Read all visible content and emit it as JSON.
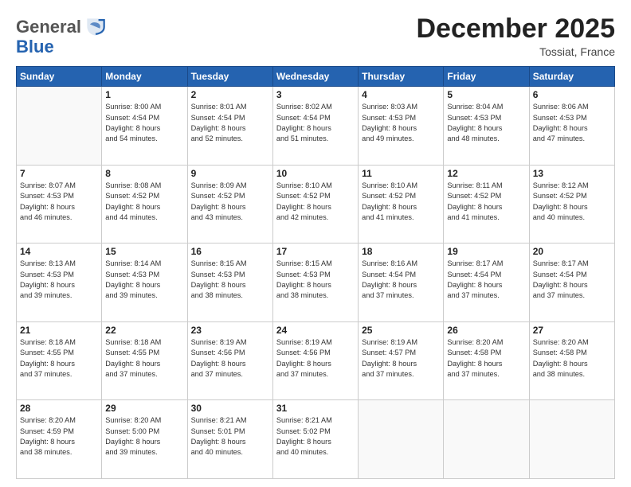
{
  "header": {
    "logo_general": "General",
    "logo_blue": "Blue",
    "month_title": "December 2025",
    "location": "Tossiat, France"
  },
  "weekdays": [
    "Sunday",
    "Monday",
    "Tuesday",
    "Wednesday",
    "Thursday",
    "Friday",
    "Saturday"
  ],
  "weeks": [
    [
      {
        "day": "",
        "sunrise": "",
        "sunset": "",
        "daylight": ""
      },
      {
        "day": "1",
        "sunrise": "Sunrise: 8:00 AM",
        "sunset": "Sunset: 4:54 PM",
        "daylight": "Daylight: 8 hours and 54 minutes."
      },
      {
        "day": "2",
        "sunrise": "Sunrise: 8:01 AM",
        "sunset": "Sunset: 4:54 PM",
        "daylight": "Daylight: 8 hours and 52 minutes."
      },
      {
        "day": "3",
        "sunrise": "Sunrise: 8:02 AM",
        "sunset": "Sunset: 4:54 PM",
        "daylight": "Daylight: 8 hours and 51 minutes."
      },
      {
        "day": "4",
        "sunrise": "Sunrise: 8:03 AM",
        "sunset": "Sunset: 4:53 PM",
        "daylight": "Daylight: 8 hours and 49 minutes."
      },
      {
        "day": "5",
        "sunrise": "Sunrise: 8:04 AM",
        "sunset": "Sunset: 4:53 PM",
        "daylight": "Daylight: 8 hours and 48 minutes."
      },
      {
        "day": "6",
        "sunrise": "Sunrise: 8:06 AM",
        "sunset": "Sunset: 4:53 PM",
        "daylight": "Daylight: 8 hours and 47 minutes."
      }
    ],
    [
      {
        "day": "7",
        "sunrise": "Sunrise: 8:07 AM",
        "sunset": "Sunset: 4:53 PM",
        "daylight": "Daylight: 8 hours and 46 minutes."
      },
      {
        "day": "8",
        "sunrise": "Sunrise: 8:08 AM",
        "sunset": "Sunset: 4:52 PM",
        "daylight": "Daylight: 8 hours and 44 minutes."
      },
      {
        "day": "9",
        "sunrise": "Sunrise: 8:09 AM",
        "sunset": "Sunset: 4:52 PM",
        "daylight": "Daylight: 8 hours and 43 minutes."
      },
      {
        "day": "10",
        "sunrise": "Sunrise: 8:10 AM",
        "sunset": "Sunset: 4:52 PM",
        "daylight": "Daylight: 8 hours and 42 minutes."
      },
      {
        "day": "11",
        "sunrise": "Sunrise: 8:10 AM",
        "sunset": "Sunset: 4:52 PM",
        "daylight": "Daylight: 8 hours and 41 minutes."
      },
      {
        "day": "12",
        "sunrise": "Sunrise: 8:11 AM",
        "sunset": "Sunset: 4:52 PM",
        "daylight": "Daylight: 8 hours and 41 minutes."
      },
      {
        "day": "13",
        "sunrise": "Sunrise: 8:12 AM",
        "sunset": "Sunset: 4:52 PM",
        "daylight": "Daylight: 8 hours and 40 minutes."
      }
    ],
    [
      {
        "day": "14",
        "sunrise": "Sunrise: 8:13 AM",
        "sunset": "Sunset: 4:53 PM",
        "daylight": "Daylight: 8 hours and 39 minutes."
      },
      {
        "day": "15",
        "sunrise": "Sunrise: 8:14 AM",
        "sunset": "Sunset: 4:53 PM",
        "daylight": "Daylight: 8 hours and 39 minutes."
      },
      {
        "day": "16",
        "sunrise": "Sunrise: 8:15 AM",
        "sunset": "Sunset: 4:53 PM",
        "daylight": "Daylight: 8 hours and 38 minutes."
      },
      {
        "day": "17",
        "sunrise": "Sunrise: 8:15 AM",
        "sunset": "Sunset: 4:53 PM",
        "daylight": "Daylight: 8 hours and 38 minutes."
      },
      {
        "day": "18",
        "sunrise": "Sunrise: 8:16 AM",
        "sunset": "Sunset: 4:54 PM",
        "daylight": "Daylight: 8 hours and 37 minutes."
      },
      {
        "day": "19",
        "sunrise": "Sunrise: 8:17 AM",
        "sunset": "Sunset: 4:54 PM",
        "daylight": "Daylight: 8 hours and 37 minutes."
      },
      {
        "day": "20",
        "sunrise": "Sunrise: 8:17 AM",
        "sunset": "Sunset: 4:54 PM",
        "daylight": "Daylight: 8 hours and 37 minutes."
      }
    ],
    [
      {
        "day": "21",
        "sunrise": "Sunrise: 8:18 AM",
        "sunset": "Sunset: 4:55 PM",
        "daylight": "Daylight: 8 hours and 37 minutes."
      },
      {
        "day": "22",
        "sunrise": "Sunrise: 8:18 AM",
        "sunset": "Sunset: 4:55 PM",
        "daylight": "Daylight: 8 hours and 37 minutes."
      },
      {
        "day": "23",
        "sunrise": "Sunrise: 8:19 AM",
        "sunset": "Sunset: 4:56 PM",
        "daylight": "Daylight: 8 hours and 37 minutes."
      },
      {
        "day": "24",
        "sunrise": "Sunrise: 8:19 AM",
        "sunset": "Sunset: 4:56 PM",
        "daylight": "Daylight: 8 hours and 37 minutes."
      },
      {
        "day": "25",
        "sunrise": "Sunrise: 8:19 AM",
        "sunset": "Sunset: 4:57 PM",
        "daylight": "Daylight: 8 hours and 37 minutes."
      },
      {
        "day": "26",
        "sunrise": "Sunrise: 8:20 AM",
        "sunset": "Sunset: 4:58 PM",
        "daylight": "Daylight: 8 hours and 37 minutes."
      },
      {
        "day": "27",
        "sunrise": "Sunrise: 8:20 AM",
        "sunset": "Sunset: 4:58 PM",
        "daylight": "Daylight: 8 hours and 38 minutes."
      }
    ],
    [
      {
        "day": "28",
        "sunrise": "Sunrise: 8:20 AM",
        "sunset": "Sunset: 4:59 PM",
        "daylight": "Daylight: 8 hours and 38 minutes."
      },
      {
        "day": "29",
        "sunrise": "Sunrise: 8:20 AM",
        "sunset": "Sunset: 5:00 PM",
        "daylight": "Daylight: 8 hours and 39 minutes."
      },
      {
        "day": "30",
        "sunrise": "Sunrise: 8:21 AM",
        "sunset": "Sunset: 5:01 PM",
        "daylight": "Daylight: 8 hours and 40 minutes."
      },
      {
        "day": "31",
        "sunrise": "Sunrise: 8:21 AM",
        "sunset": "Sunset: 5:02 PM",
        "daylight": "Daylight: 8 hours and 40 minutes."
      },
      {
        "day": "",
        "sunrise": "",
        "sunset": "",
        "daylight": ""
      },
      {
        "day": "",
        "sunrise": "",
        "sunset": "",
        "daylight": ""
      },
      {
        "day": "",
        "sunrise": "",
        "sunset": "",
        "daylight": ""
      }
    ]
  ]
}
